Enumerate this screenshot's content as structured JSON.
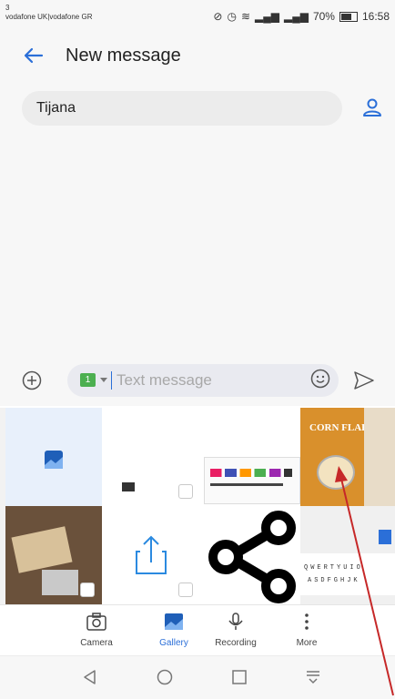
{
  "status_bar": {
    "carrier_line1": "3",
    "carrier_line2": "vodafone UK|vodafone GR",
    "battery": "70%",
    "time": "16:58"
  },
  "header": {
    "title": "New message",
    "back_icon": "back-arrow-icon"
  },
  "recipient": {
    "name": "Tijana",
    "contact_icon": "person-icon"
  },
  "composer": {
    "placeholder": "Text message",
    "add_icon": "plus-circle-icon",
    "emoji_icon": "smiley-icon",
    "send_icon": "send-icon",
    "sim_label": "1"
  },
  "gallery": {
    "tiles": [
      {
        "name": "gallery-picker-tile"
      },
      {
        "name": "screenshot-tile"
      },
      {
        "name": "screenshot-apps-tile"
      },
      {
        "name": "cornflakes-photo-tile",
        "text": "CORN FLAKES"
      },
      {
        "name": "photo-tile"
      },
      {
        "name": "share-export-tile"
      },
      {
        "name": "share-icon-tile"
      },
      {
        "name": "keyboard-screenshot-tile"
      }
    ]
  },
  "bottom_tabs": [
    {
      "label": "Camera",
      "icon": "camera-icon"
    },
    {
      "label": "Gallery",
      "icon": "gallery-icon",
      "active": true
    },
    {
      "label": "Recording",
      "icon": "microphone-icon"
    },
    {
      "label": "More",
      "icon": "more-vertical-icon"
    }
  ],
  "nav_bar": {
    "back": "nav-back-icon",
    "home": "nav-home-icon",
    "recents": "nav-recents-icon",
    "notifications": "nav-pulldown-icon"
  },
  "colors": {
    "accent": "#2b6fd8",
    "background": "#f7f7f7",
    "annotation_arrow": "#c62828"
  }
}
